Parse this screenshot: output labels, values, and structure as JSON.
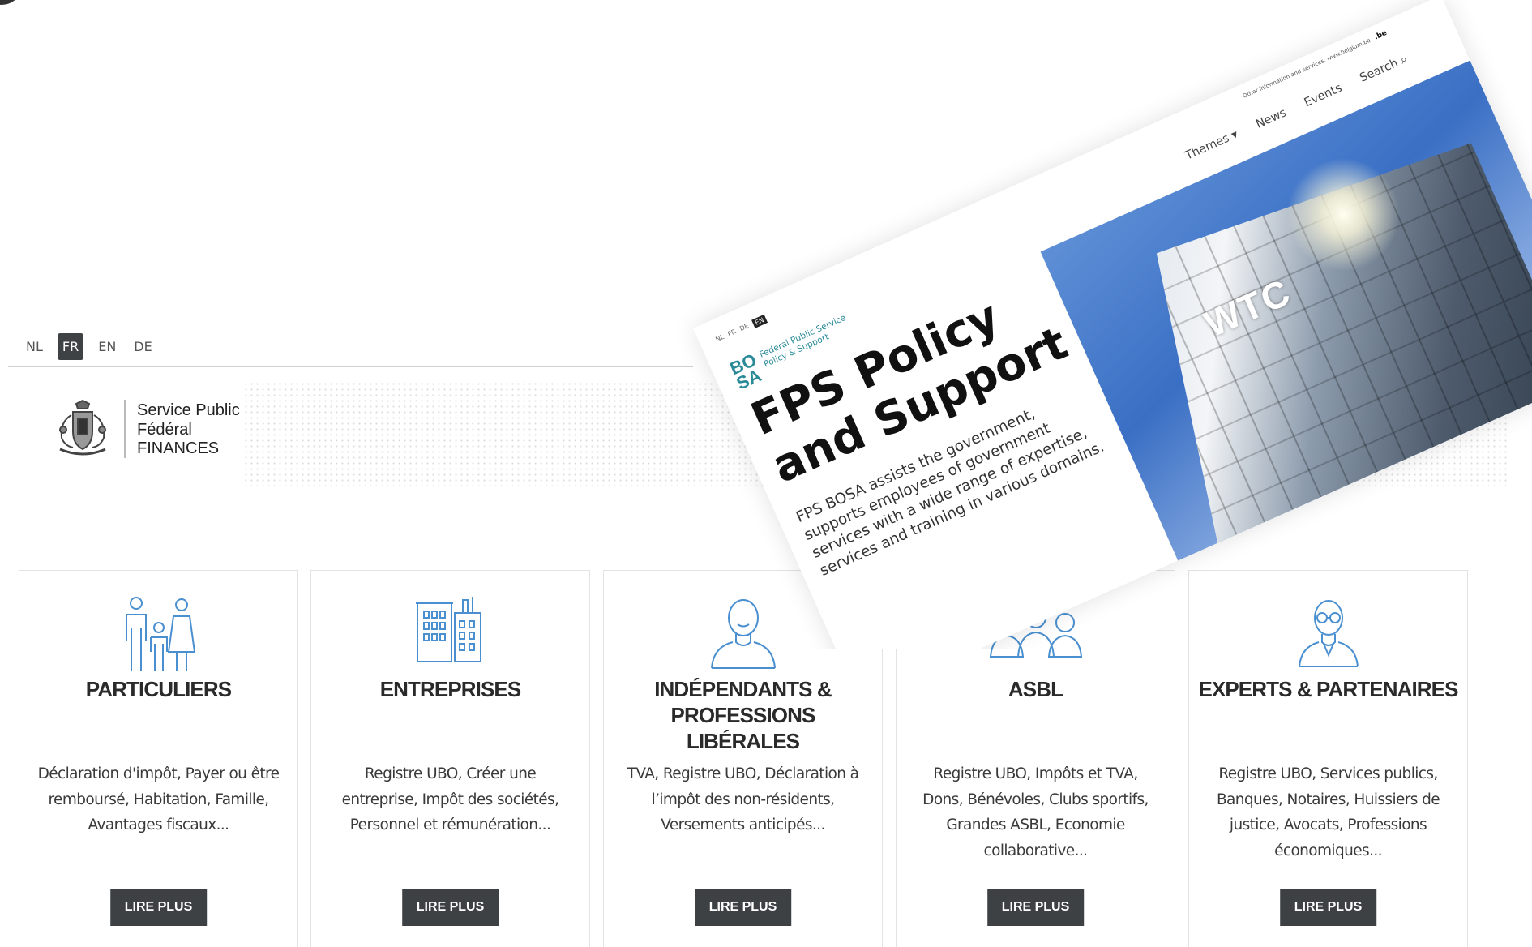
{
  "languages": [
    "NL",
    "FR",
    "EN",
    "DE"
  ],
  "active_language": "FR",
  "org": {
    "line1": "Service Public",
    "line2": "Fédéral",
    "line3": "FINANCES"
  },
  "cards": [
    {
      "title": "PARTICULIERS",
      "desc": "Déclaration d'impôt, Payer ou être remboursé, Habitation, Famille, Avantages fiscaux...",
      "button": "LIRE PLUS",
      "icon": "family-icon"
    },
    {
      "title": "ENTREPRISES",
      "desc": "Registre UBO, Créer une entreprise, Impôt des sociétés, Personnel et rémunération...",
      "button": "LIRE PLUS",
      "icon": "buildings-icon"
    },
    {
      "title": "INDÉPENDANTS & PROFESSIONS LIBÉRALES",
      "desc": "TVA, Registre UBO, Déclaration à l’impôt des non-résidents, Versements anticipés...",
      "button": "LIRE PLUS",
      "icon": "person-icon"
    },
    {
      "title": "ASBL",
      "desc": "Registre UBO, Impôts et TVA, Dons, Bénévoles, Clubs sportifs, Grandes ASBL, Economie collaborative...",
      "button": "LIRE PLUS",
      "icon": "group-icon"
    },
    {
      "title": "EXPERTS & PARTENAIRES",
      "desc": "Registre UBO, Services publics, Banques, Notaires, Huissiers de justice, Avocats, Professions économiques...",
      "button": "LIRE PLUS",
      "icon": "expert-icon"
    }
  ],
  "overlay": {
    "langs": [
      "NL",
      "FR",
      "DE",
      "EN"
    ],
    "active_lang": "EN",
    "logo_line1": "BO",
    "logo_line2": "SA",
    "logo_text1": "Federal Public Service",
    "logo_text2": "Policy & Support",
    "headline": "FPS Policy and Support",
    "lead": "FPS BOSA assists the government, supports employees of government services with a wide range of expertise, services and training in various domains.",
    "top_links": "Other information and services: www.belgium.be",
    "belgium_mark": ".be",
    "nav": [
      "Themes ▾",
      "News",
      "Events",
      "Search"
    ],
    "photo_text": "WTC"
  }
}
